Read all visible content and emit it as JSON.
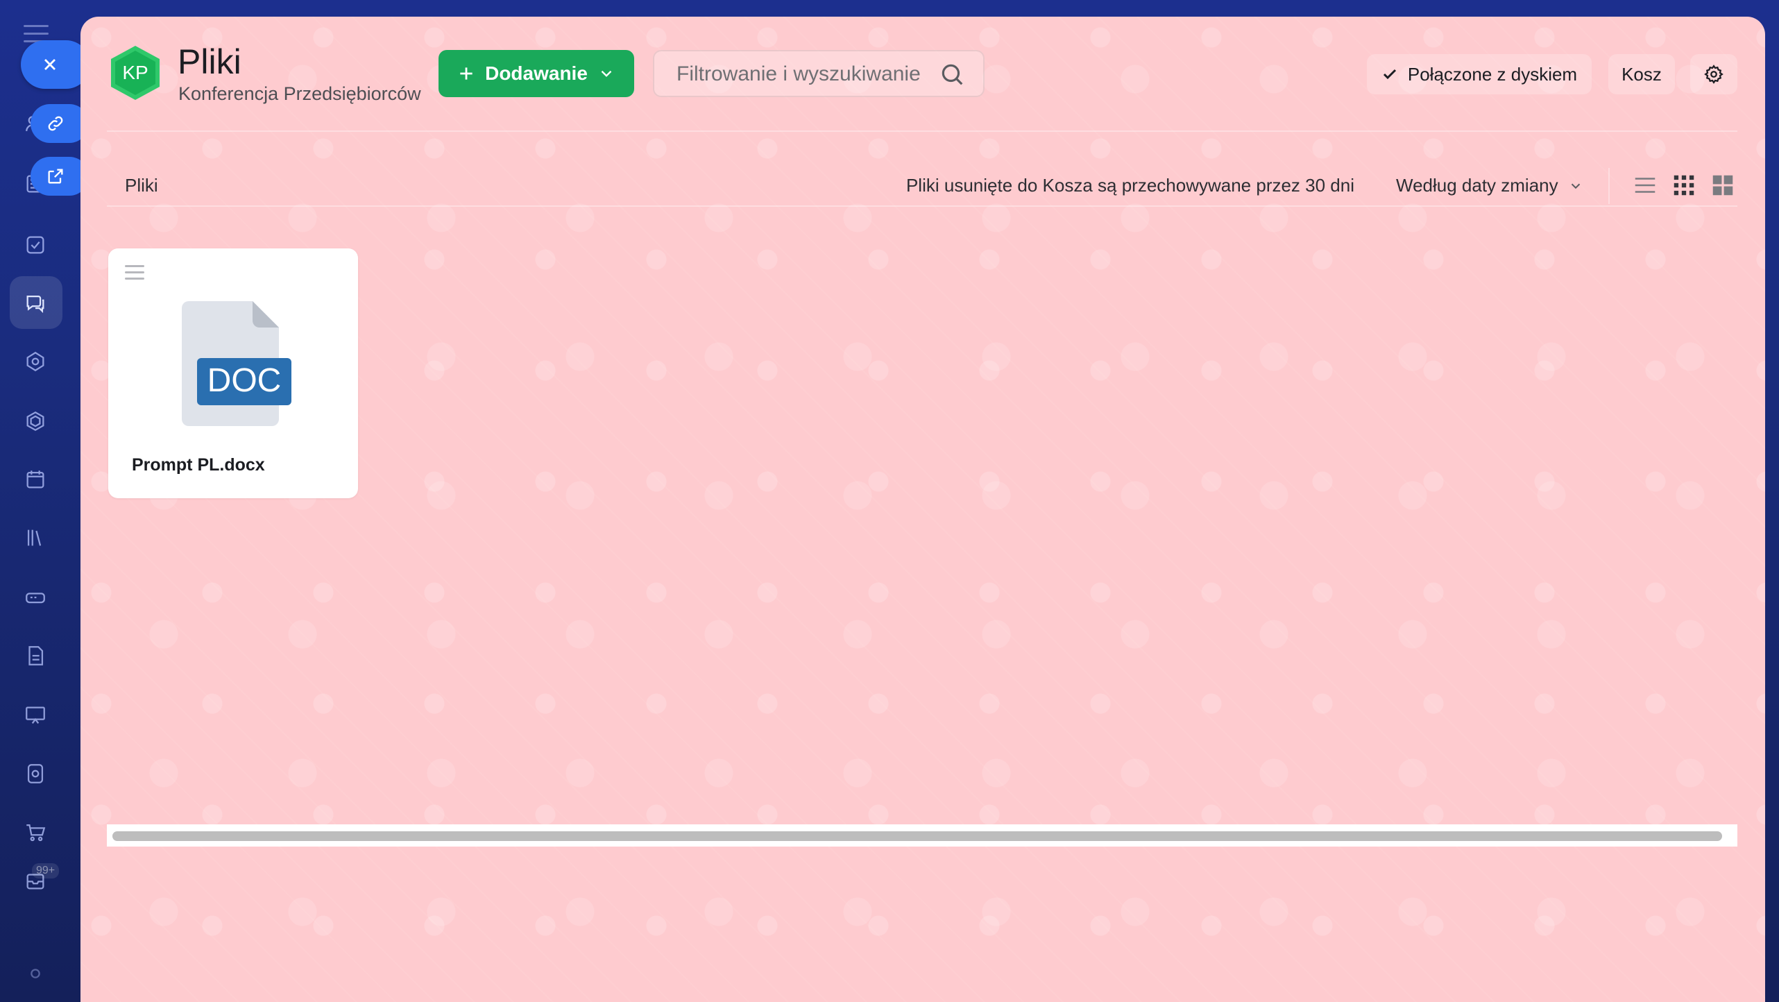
{
  "panel": {
    "logo_initials": "KP",
    "title": "Pliki",
    "subtitle": "Konferencja Przedsiębiorców",
    "add_button": "Dodawanie",
    "search_placeholder": "Filtrowanie i wyszukiwanie",
    "disk_button": "Połączone z dyskiem",
    "trash_button": "Kosz"
  },
  "toolbar": {
    "breadcrumb": "Pliki",
    "retention_note": "Pliki usunięte do Kosza są przechowywane przez 30 dni",
    "sort_label": "Według daty zmiany"
  },
  "files": [
    {
      "name": "Prompt PL.docx",
      "type_label": "DOC"
    }
  ],
  "sidebar": {
    "badge": "99+"
  },
  "colors": {
    "accent_green": "#1aa95a",
    "panel_bg": "#fecbcf",
    "doc_blue": "#2a6fb0",
    "sidebar_blue": "#2f6ff0"
  }
}
